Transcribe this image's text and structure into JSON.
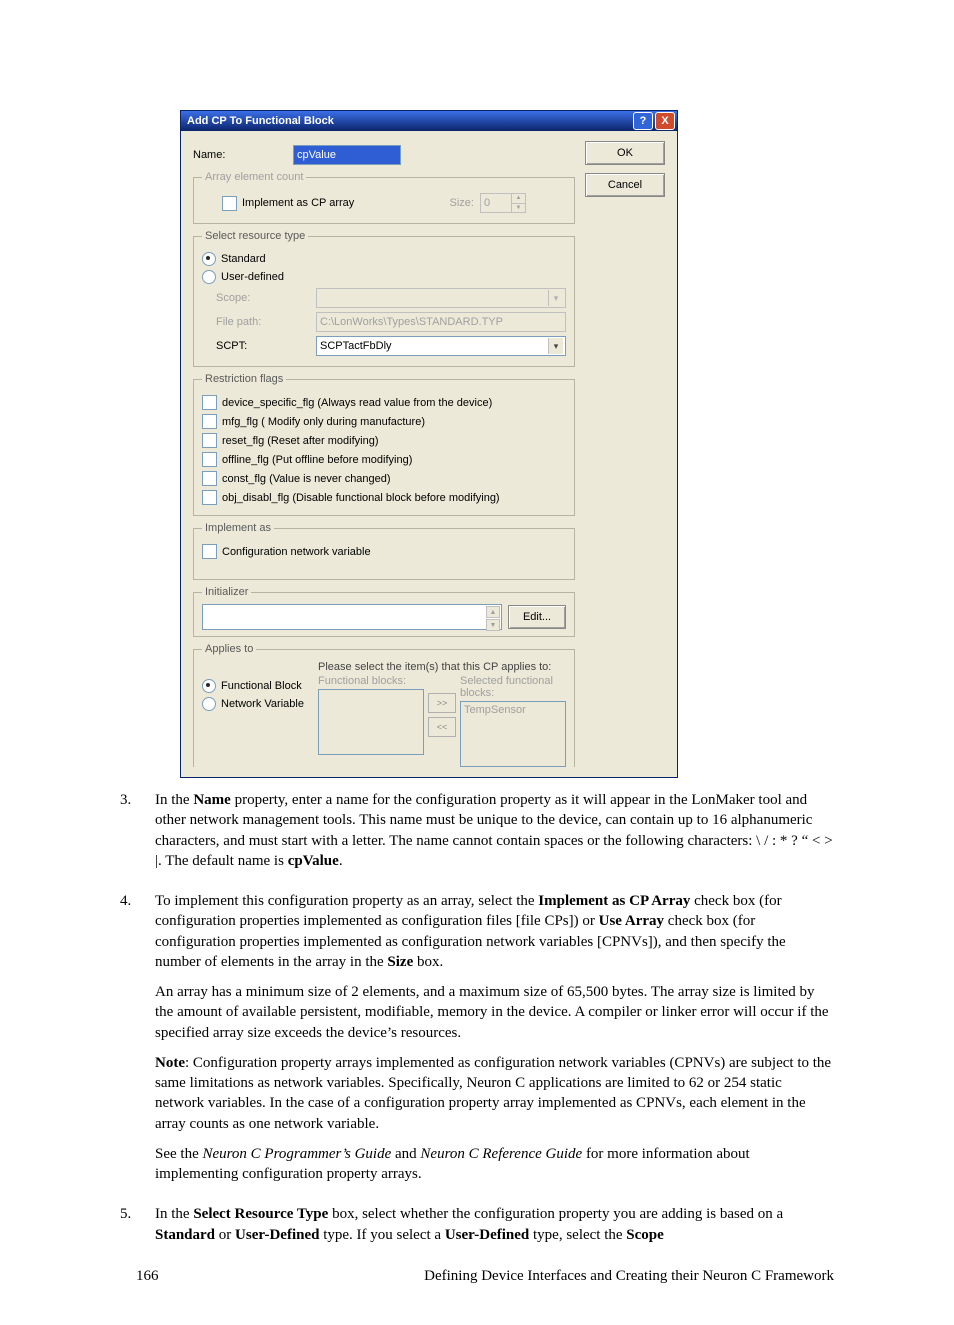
{
  "dialog": {
    "title": "Add CP To Functional Block",
    "ok": "OK",
    "cancel": "Cancel",
    "name_label": "Name:",
    "name_value": "cpValue",
    "array": {
      "legend": "Array element count",
      "impl_label": "Implement as CP array",
      "size_label": "Size:",
      "size_value": "0"
    },
    "resource": {
      "legend": "Select resource type",
      "standard": "Standard",
      "user_defined": "User-defined",
      "scope_label": "Scope:",
      "filepath_label": "File path:",
      "filepath_value": "C:\\LonWorks\\Types\\STANDARD.TYP",
      "scpt_label": "SCPT:",
      "scpt_value": "SCPTactFbDly"
    },
    "flags": {
      "legend": "Restriction flags",
      "f1": "device_specific_flg  (Always read value from the device)",
      "f2": "mfg_flg  ( Modify only during manufacture)",
      "f3": "reset_flg  (Reset after modifying)",
      "f4": "offline_flg  (Put offline before modifying)",
      "f5": "const_flg  (Value is never changed)",
      "f6": "obj_disabl_flg  (Disable functional block before modifying)"
    },
    "impl": {
      "legend": "Implement as",
      "cnv": "Configuration network variable"
    },
    "init": {
      "legend": "Initializer",
      "edit": "Edit..."
    },
    "applies": {
      "legend": "Applies to",
      "instr": "Please select the item(s) that this CP applies to:",
      "fb": "Functional Block",
      "nv": "Network Variable",
      "left_hdr": "Functional blocks:",
      "right_hdr": "Selected functional blocks:",
      "right_item": "TempSensor",
      "move_r": ">>",
      "move_l": "<<"
    }
  },
  "doc": {
    "i3": {
      "num": "3.",
      "text": "In the <b>Name</b> property, enter a name for the configuration property as it will appear in the LonMaker tool and other network management tools.  This name must be unique to the device, can contain up to 16 alphanumeric characters, and must start with a letter.  The name cannot contain spaces or the following characters: \\ / : * ? “ < > |.  The default name is <b>cpValue</b>."
    },
    "i4": {
      "num": "4.",
      "p1": "To implement this configuration property as an array, select the <b>Implement as CP Array</b> check box (for configuration properties implemented as configuration files [file CPs]) or <b>Use Array</b> check box (for configuration properties implemented as configuration network variables [CPNVs]), and then specify the number of elements in the array in the <b>Size</b> box.",
      "p2": "An array has a minimum size of 2 elements, and a maximum size of 65,500 bytes.  The array size is limited by the amount of available persistent, modifiable, memory in the device.  A compiler or linker error will occur if the specified array size exceeds the device’s resources.",
      "p3": "<b>Note</b>:  Configuration property arrays implemented as configuration network variables (CPNVs) are subject to the same limitations as network variables.  Specifically, Neuron C applications are limited to 62 or 254 static network variables.  In the case of a configuration property array implemented as CPNVs, each element in the array counts as one network variable.",
      "p4": "See the <i>Neuron C Programmer’s Guide</i> and <i>Neuron C Reference Guide</i> for more information about implementing configuration property arrays."
    },
    "i5": {
      "num": "5.",
      "text": "In the <b>Select Resource Type</b> box, select whether the configuration property you are adding is based on a <b>Standard</b> or <b>User-Defined</b> type.  If you select a <b>User-Defined</b> type, select the <b>Scope</b>"
    }
  },
  "footer": {
    "page": "166",
    "title": "Defining Device Interfaces and Creating their Neuron C Framework"
  }
}
